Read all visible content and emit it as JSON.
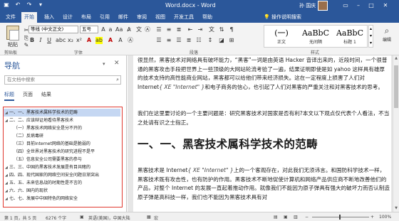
{
  "titlebar": {
    "title": "Word.docx - Word",
    "user": "孙 国庆",
    "qat": [
      "save-icon",
      "undo-icon",
      "redo-icon",
      "customize-icon"
    ],
    "controls": [
      "restore-ribbon-icon",
      "minimize-icon",
      "maximize-icon",
      "close-icon"
    ]
  },
  "tabs": [
    "文件",
    "开始",
    "插入",
    "设计",
    "布局",
    "引用",
    "邮件",
    "审阅",
    "视图",
    "开发工具",
    "帮助"
  ],
  "tell_me": "操作说明搜索",
  "ribbon": {
    "paste_label": "粘贴",
    "font_name": "等线 (中文正文)",
    "font_size": "五号",
    "styles": [
      {
        "preview": "(一)",
        "name": "正文"
      },
      {
        "preview": "AaBbC",
        "name": "无间隔"
      },
      {
        "preview": "AaBbC",
        "name": "标题 1"
      }
    ],
    "editing_label": "编辑",
    "groups": [
      "剪贴板",
      "字体",
      "段落",
      "样式"
    ]
  },
  "nav": {
    "title": "导航",
    "search_placeholder": "在文档中搜索",
    "tabs": [
      "标题",
      "页面",
      "结果"
    ],
    "outline": [
      {
        "text": "一、一、黑客技术属科学技术的范畴",
        "selected": true
      },
      {
        "text": "二、二、应该辩证地看待黑客技术",
        "selected": false
      },
      {
        "text": "（一）黑客技术网络安全是分不开的",
        "selected": false
      },
      {
        "text": "（二）反病毒研",
        "selected": false
      },
      {
        "text": "（三）目前Internet网络的基础是脆弱的",
        "selected": false
      },
      {
        "text": "（四）全世界对黑客技术的研究进程不是平",
        "selected": false
      },
      {
        "text": "（五）信息安全公司需要黑客的参与",
        "selected": false
      },
      {
        "text": "三、三、中国的黑客技术发展是有目共睹的",
        "selected": false
      },
      {
        "text": "四、四、现代国家的网络空间安全问题日渐突出",
        "selected": false
      },
      {
        "text": "五、五、未来信息战的时期性是不言的",
        "selected": false
      },
      {
        "text": "六、六、国内的现状",
        "selected": false
      },
      {
        "text": "七、七、发展中中国特色的网络安全",
        "selected": false
      }
    ]
  },
  "doc": {
    "para1": "很显然，黑客技术对网络具有破坏能力，“黑客”一词是由英语 Hacker 音译出来的，近段时间，一个很普通的黑客攻击手段把世界上一些顶级的大网站轮流考验了一遍，结果证明即使是如 yahoo 这样具有雄厚的技术支持的高性能商业网站，黑客都可以给他们带来经济损失。这在一定程度上损害了人们对 Internet",
    "field1": "{ XE \"Internet\" }",
    "para1_tail": "和电子商务的信心，也引起了人们对黑客的严重关注和对黑客技术的思考。",
    "para2": "我们在这里要讨论的一个主要问题是：研究黑客技术对国家是否有利?本文以下观点仅代表个人看法，不当之处请有识之士指正。",
    "heading": "一、一、黑客技术属科学技术的范畴",
    "para3": "黑客技术是 Internet",
    "field2": "{ XE \"Internet\" }",
    "para3_tail": "上的一个客观存在，对此我们无须讳言。和国防科学技术一样，黑客技术既有攻击性，也有防护的作用。黑客技术不断地促使计算机和网络产品供应商不断地改善他们的产品，对整个 Internet 的发展一直起着推动作用。就像我们不能因为原子弹具有强大的破坏力而否认制造原子弹是高科技一样，我们也不能因为黑客技术具有对"
  },
  "status": {
    "page": "第 1 页，共 5 页",
    "words": "6276 个字",
    "language": "英语(美国)，中国大陆",
    "macro": "宏",
    "zoom": "100%"
  }
}
